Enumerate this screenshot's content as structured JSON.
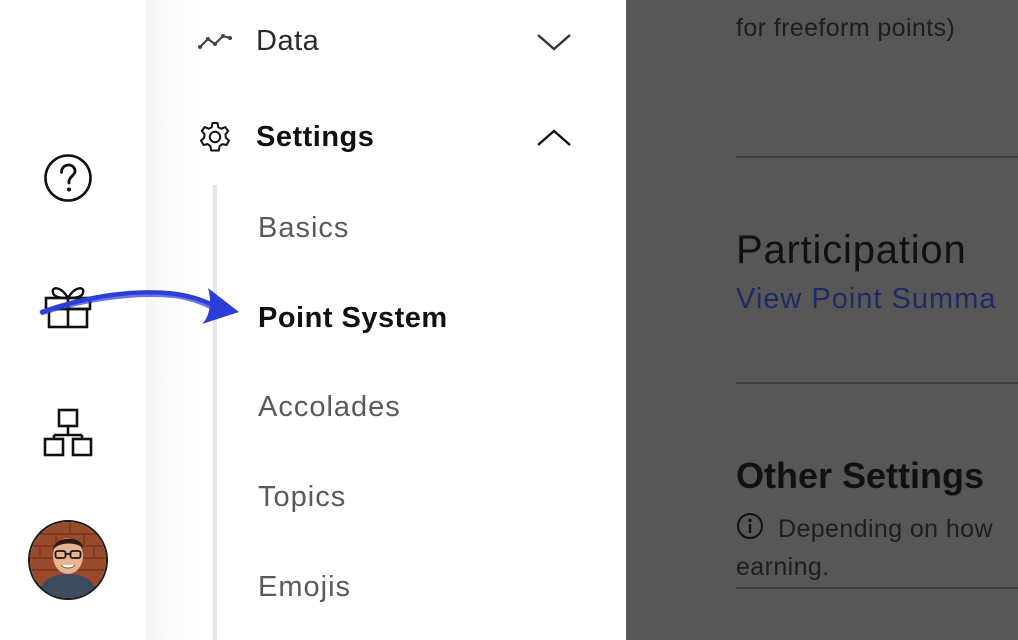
{
  "rail": {
    "icons": [
      "help-icon",
      "gift-icon",
      "org-chart-icon"
    ],
    "avatar": "user-avatar"
  },
  "menu": {
    "data": {
      "label": "Data",
      "icon": "line-chart-icon",
      "chevron": "chevron-down-icon"
    },
    "settings": {
      "label": "Settings",
      "icon": "gear-icon",
      "chevron": "chevron-up-icon"
    },
    "sub_items": [
      "Basics",
      "Point System",
      "Accolades",
      "Topics",
      "Emojis"
    ],
    "active_sub_item": "Point System"
  },
  "content": {
    "top_text": "for freeform points)",
    "participation_heading": "Participation",
    "participation_link": "View Point Summa",
    "other_heading": "Other Settings",
    "info_text": "Depending on how",
    "info_text_cont": "earning."
  },
  "colors": {
    "overlay": "#575757",
    "link": "#1f2a63",
    "annotation_arrow": "#2b3fd6"
  }
}
